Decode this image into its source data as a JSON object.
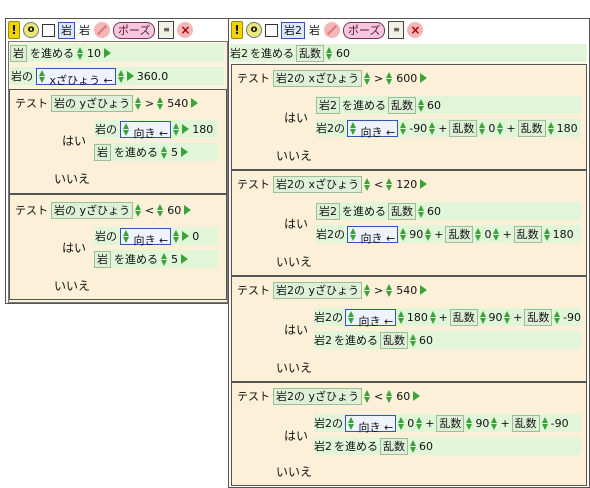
{
  "left": {
    "toolbar": {
      "excl": "!",
      "o": "o",
      "name_tile": "岩",
      "name_text": "岩",
      "pause": "ポーズ",
      "close": "×"
    },
    "script": [
      {
        "obj": "岩",
        "verb": "を進める",
        "value": "10"
      },
      {
        "owner": "岩の",
        "attr": "xざひょう",
        "arrow": "←",
        "value": "360.0"
      }
    ],
    "tests": [
      {
        "test_label": "テスト",
        "cond_owner": "岩の",
        "cond_attr": "yざひょう",
        "op": ">",
        "cond_value": "540",
        "yes_label": "はい",
        "yes": [
          {
            "owner": "岩の",
            "attr": "向き",
            "arrow": "←",
            "value": "180"
          },
          {
            "obj": "岩",
            "verb": "を進める",
            "value": "5"
          }
        ],
        "no_label": "いいえ"
      },
      {
        "test_label": "テスト",
        "cond_owner": "岩の",
        "cond_attr": "yざひょう",
        "op": "<",
        "cond_value": "60",
        "yes_label": "はい",
        "yes": [
          {
            "owner": "岩の",
            "attr": "向き",
            "arrow": "←",
            "value": "0"
          },
          {
            "obj": "岩",
            "verb": "を進める",
            "value": "5"
          }
        ],
        "no_label": "いいえ"
      }
    ]
  },
  "right": {
    "toolbar": {
      "excl": "!",
      "o": "o",
      "name_tile": "岩2",
      "name_text": "岩",
      "pause": "ポーズ",
      "close": "×"
    },
    "script": [
      {
        "obj": "岩2",
        "verb": "を進める",
        "rand": "乱数",
        "value": "60"
      }
    ],
    "tests": [
      {
        "test_label": "テスト",
        "cond_owner": "岩2の",
        "cond_attr": "xざひょう",
        "op": ">",
        "cond_value": "600",
        "yes_label": "はい",
        "move": {
          "obj": "岩2",
          "verb": "を進める",
          "rand": "乱数",
          "value": "60"
        },
        "set": {
          "owner": "岩2の",
          "attr": "向き",
          "arrow": "←",
          "v1": "-90",
          "op1": "+",
          "r1": "乱数",
          "v2": "0",
          "op2": "+",
          "r2": "乱数",
          "v3": "180"
        },
        "no_label": "いいえ"
      },
      {
        "test_label": "テスト",
        "cond_owner": "岩2の",
        "cond_attr": "xざひょう",
        "op": "<",
        "cond_value": "120",
        "yes_label": "はい",
        "move": {
          "obj": "岩2",
          "verb": "を進める",
          "rand": "乱数",
          "value": "60"
        },
        "set": {
          "owner": "岩2の",
          "attr": "向き",
          "arrow": "←",
          "v1": "90",
          "op1": "+",
          "r1": "乱数",
          "v2": "0",
          "op2": "+",
          "r2": "乱数",
          "v3": "180"
        },
        "no_label": "いいえ"
      },
      {
        "test_label": "テスト",
        "cond_owner": "岩2の",
        "cond_attr": "yざひょう",
        "op": ">",
        "cond_value": "540",
        "yes_label": "はい",
        "set": {
          "owner": "岩2の",
          "attr": "向き",
          "arrow": "←",
          "v1": "180",
          "op1": "+",
          "r1": "乱数",
          "v2": "90",
          "op2": "+",
          "r2": "乱数",
          "v3": "-90"
        },
        "move": {
          "obj": "岩2",
          "verb": "を進める",
          "rand": "乱数",
          "value": "60"
        },
        "no_label": "いいえ"
      },
      {
        "test_label": "テスト",
        "cond_owner": "岩2の",
        "cond_attr": "yざひょう",
        "op": "<",
        "cond_value": "60",
        "yes_label": "はい",
        "set": {
          "owner": "岩2の",
          "attr": "向き",
          "arrow": "←",
          "v1": "0",
          "op1": "+",
          "r1": "乱数",
          "v2": "90",
          "op2": "+",
          "r2": "乱数",
          "v3": "-90"
        },
        "move": {
          "obj": "岩2",
          "verb": "を進める",
          "rand": "乱数",
          "value": "60"
        },
        "no_label": "いいえ"
      }
    ]
  }
}
